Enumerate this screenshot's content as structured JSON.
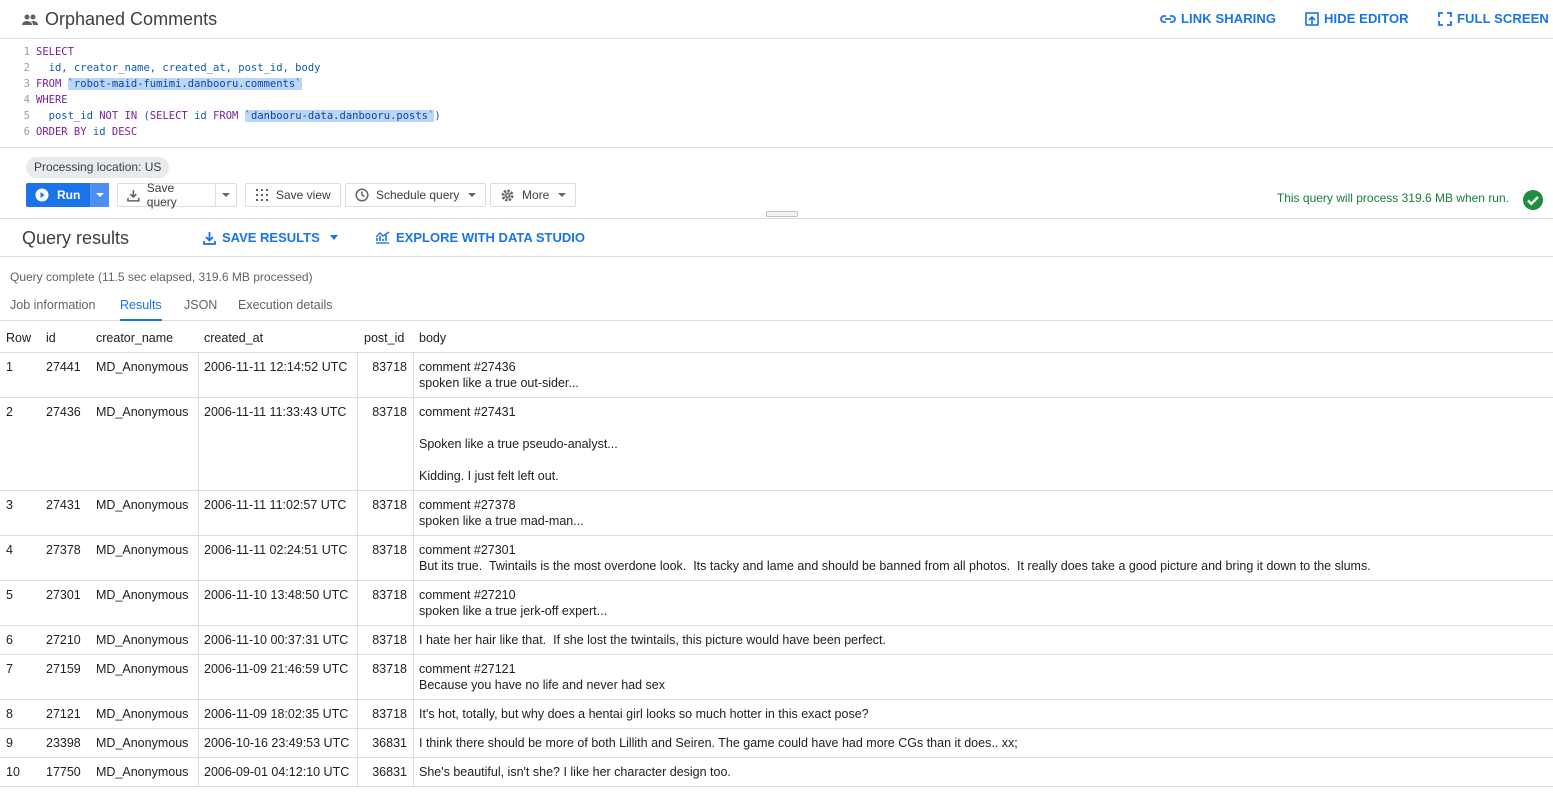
{
  "header": {
    "title": "Orphaned Comments",
    "link_sharing": "LINK SHARING",
    "hide_editor": "HIDE EDITOR",
    "full_screen": "FULL SCREEN"
  },
  "editor": {
    "line_numbers": [
      "1",
      "2",
      "3",
      "4",
      "5",
      "6"
    ],
    "lines": [
      {
        "kw1": "SELECT",
        "rest": ""
      },
      {
        "text": "  id, creator_name, created_at, post_id, body"
      },
      {
        "kw1": "FROM ",
        "hl": "`robot-maid-fumimi.danbooru.comments`"
      },
      {
        "kw1": "WHERE",
        "rest": ""
      },
      {
        "pre": "  post_id ",
        "kw_a": "NOT IN",
        "mid1": " (",
        "kw_b": "SELECT",
        "mid2": " id ",
        "kw_c": "FROM",
        "mid3": " ",
        "hl": "`danbooru-data.danbooru.posts`",
        "post": ")"
      },
      {
        "kw1": "ORDER BY",
        "rest": " id ",
        "kw2": "DESC"
      }
    ]
  },
  "toolbar": {
    "processing_location": "Processing location: US",
    "run": "Run",
    "save_query": "Save query",
    "save_view": "Save view",
    "schedule_query": "Schedule query",
    "more": "More",
    "process_message": "This query will process 319.6 MB when run."
  },
  "results": {
    "title": "Query results",
    "save_results": "SAVE RESULTS",
    "explore": "EXPLORE WITH DATA STUDIO",
    "status": "Query complete (11.5 sec elapsed, 319.6 MB processed)",
    "tabs": [
      "Job information",
      "Results",
      "JSON",
      "Execution details"
    ],
    "active_tab": "Results",
    "columns": [
      "Row",
      "id",
      "creator_name",
      "created_at",
      "post_id",
      "body"
    ],
    "rows": [
      {
        "row": "1",
        "id": "27441",
        "creator": "MD_Anonymous",
        "created": "2006-11-11 12:14:52 UTC",
        "post": "83718",
        "body": "comment #27436\nspoken like a true out-sider..."
      },
      {
        "row": "2",
        "id": "27436",
        "creator": "MD_Anonymous",
        "created": "2006-11-11 11:33:43 UTC",
        "post": "83718",
        "body": "comment #27431\n\nSpoken like a true pseudo-analyst...\n\nKidding. I just felt left out."
      },
      {
        "row": "3",
        "id": "27431",
        "creator": "MD_Anonymous",
        "created": "2006-11-11 11:02:57 UTC",
        "post": "83718",
        "body": "comment #27378\nspoken like a true mad-man..."
      },
      {
        "row": "4",
        "id": "27378",
        "creator": "MD_Anonymous",
        "created": "2006-11-11 02:24:51 UTC",
        "post": "83718",
        "body": "comment #27301\nBut its true.  Twintails is the most overdone look.  Its tacky and lame and should be banned from all photos.  It really does take a good picture and bring it down to the slums."
      },
      {
        "row": "5",
        "id": "27301",
        "creator": "MD_Anonymous",
        "created": "2006-11-10 13:48:50 UTC",
        "post": "83718",
        "body": "comment #27210\nspoken like a true jerk-off expert..."
      },
      {
        "row": "6",
        "id": "27210",
        "creator": "MD_Anonymous",
        "created": "2006-11-10 00:37:31 UTC",
        "post": "83718",
        "body": "I hate her hair like that.  If she lost the twintails, this picture would have been perfect."
      },
      {
        "row": "7",
        "id": "27159",
        "creator": "MD_Anonymous",
        "created": "2006-11-09 21:46:59 UTC",
        "post": "83718",
        "body": "comment #27121\nBecause you have no life and never had sex"
      },
      {
        "row": "8",
        "id": "27121",
        "creator": "MD_Anonymous",
        "created": "2006-11-09 18:02:35 UTC",
        "post": "83718",
        "body": "It's hot, totally, but why does a hentai girl looks so much hotter in this exact pose?"
      },
      {
        "row": "9",
        "id": "23398",
        "creator": "MD_Anonymous",
        "created": "2006-10-16 23:49:53 UTC",
        "post": "36831",
        "body": "I think there should be more of both Lillith and Seiren. The game could have had more CGs than it does.. xx;"
      },
      {
        "row": "10",
        "id": "17750",
        "creator": "MD_Anonymous",
        "created": "2006-09-01 04:12:10 UTC",
        "post": "36831",
        "body": "She's beautiful, isn't she? I like her character design too."
      }
    ]
  },
  "colors": {
    "accent": "#1a73e8",
    "success": "#188038",
    "keyword": "#7a1f9c",
    "highlight": "#bbd6f9"
  }
}
